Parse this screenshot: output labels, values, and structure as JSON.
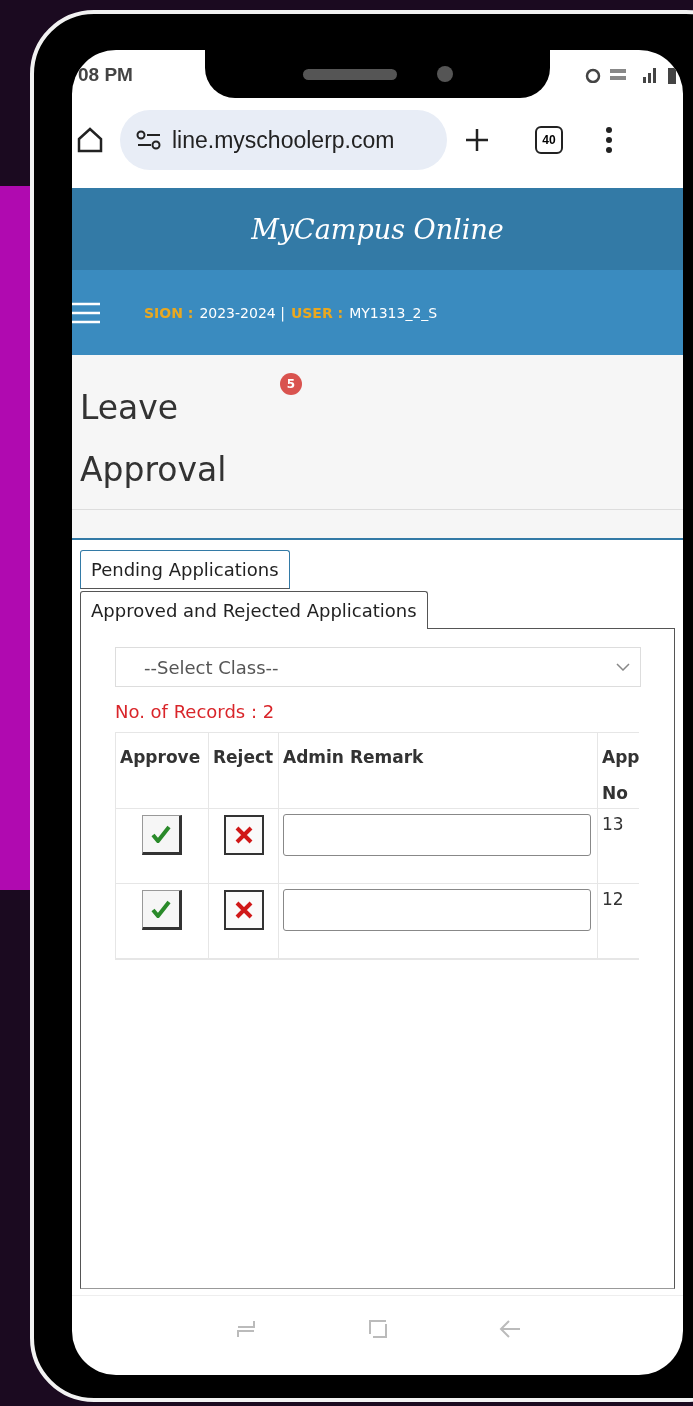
{
  "status_bar": {
    "time": "08 PM"
  },
  "browser": {
    "url": "line.myschoolerp.com",
    "tab_count": "40"
  },
  "app": {
    "title": "MyCampus Online"
  },
  "session_bar": {
    "session_label": "SION :",
    "session_value": "2023-2024 |",
    "user_label": "USER :",
    "user_value": "MY1313_2_S"
  },
  "page": {
    "title": "Leave Approval",
    "badge": "5"
  },
  "tabs": [
    {
      "label": "Pending Applications",
      "selected": false
    },
    {
      "label": "Approved and Rejected Applications",
      "selected": true
    }
  ],
  "class_select": {
    "placeholder": "--Select Class--"
  },
  "records": "No. of Records : 2",
  "table": {
    "columns": [
      "Approve",
      "Reject",
      "Admin Remark",
      "App No"
    ],
    "rows": [
      {
        "app_no": "13"
      },
      {
        "app_no": "12"
      }
    ]
  }
}
